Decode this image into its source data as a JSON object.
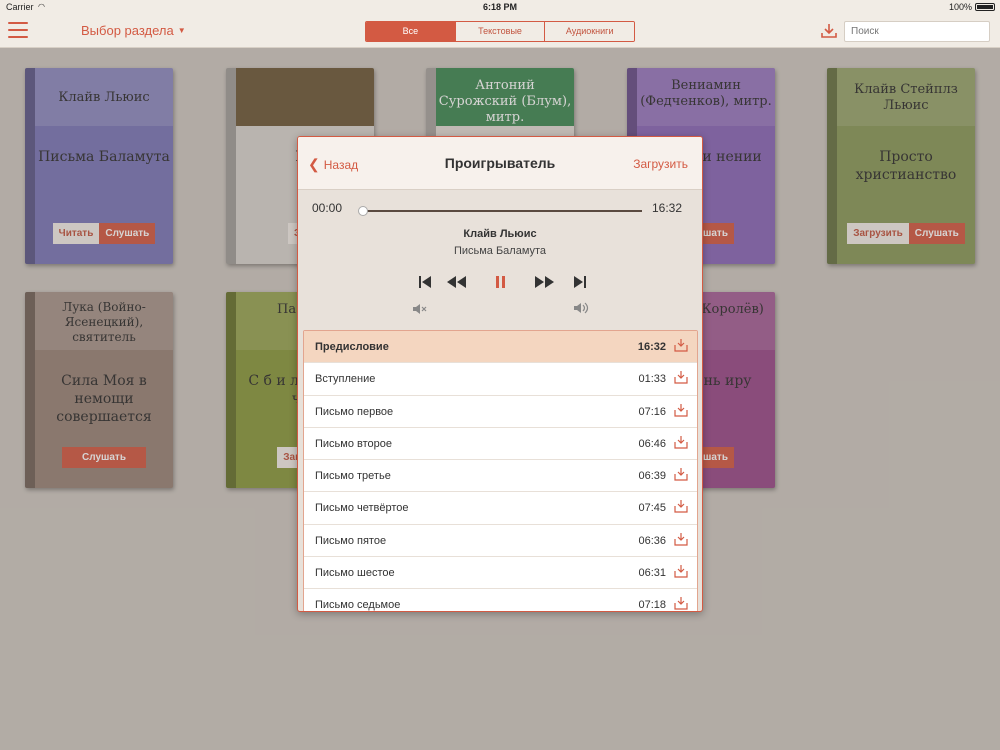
{
  "status_bar": {
    "carrier": "Carrier",
    "time": "6:18 PM",
    "battery": "100%"
  },
  "navbar": {
    "section_select": "Выбор раздела",
    "segments": [
      {
        "label": "Все",
        "active": true
      },
      {
        "label": "Текстовые",
        "active": false
      },
      {
        "label": "Аудиокниги",
        "active": false
      }
    ],
    "search_placeholder": "Поиск"
  },
  "books": [
    {
      "author": "Клайв Льюис",
      "title": "Письма Баламута",
      "color": "#7b77b8",
      "buttons": [
        "Читать",
        "Слушать"
      ]
    },
    {
      "author": "",
      "title": "Би",
      "color": "#a49d95",
      "buttons": [
        "Загр"
      ]
    },
    {
      "author": "Антоний Сурожский (Блум), митр.",
      "title": "",
      "color": "#3f8a55",
      "buttons": []
    },
    {
      "author": "Вениамин (Федченков), митр.",
      "title": "неверии нении",
      "color": "#8a67b8",
      "buttons": [
        "Слушать"
      ]
    },
    {
      "author": "Клайв Стейплз Льюис",
      "title": "Просто христианство",
      "color": "#8a9a5a",
      "buttons": [
        "Загрузить",
        "Слушать"
      ]
    },
    {
      "author": "Лука (Войно-Ясенецкий), святитель",
      "title": "Сила Моя в немощи совершается",
      "color": "#9a8478",
      "buttons": [
        "Слушать"
      ]
    },
    {
      "author": "Па Свят",
      "title": "С б и лю о совр чел",
      "color": "#8a9a3e",
      "buttons": [
        "Загрузит"
      ]
    },
    {
      "author": "пископ Королёв)",
      "title": "я жизнь иру",
      "color": "#9a4a8a",
      "buttons": [
        "Слушать"
      ]
    }
  ],
  "player": {
    "back_label": "Назад",
    "title": "Проигрыватель",
    "load_label": "Загрузить",
    "time_current": "00:00",
    "time_total": "16:32",
    "progress": 0,
    "author": "Клайв Льюис",
    "book": "Письма Баламута",
    "tracks": [
      {
        "name": "Предисловие",
        "duration": "16:32",
        "active": true
      },
      {
        "name": "Вступление",
        "duration": "01:33",
        "active": false
      },
      {
        "name": "Письмо первое",
        "duration": "07:16",
        "active": false
      },
      {
        "name": "Письмо второе",
        "duration": "06:46",
        "active": false
      },
      {
        "name": "Письмо третье",
        "duration": "06:39",
        "active": false
      },
      {
        "name": "Письмо четвёртое",
        "duration": "07:45",
        "active": false
      },
      {
        "name": "Письмо пятое",
        "duration": "06:36",
        "active": false
      },
      {
        "name": "Письмо шестое",
        "duration": "06:31",
        "active": false
      },
      {
        "name": "Письмо седьмое",
        "duration": "07:18",
        "active": false
      }
    ]
  },
  "colors": {
    "accent": "#d35a43",
    "bar_bg": "#f1ece5"
  }
}
